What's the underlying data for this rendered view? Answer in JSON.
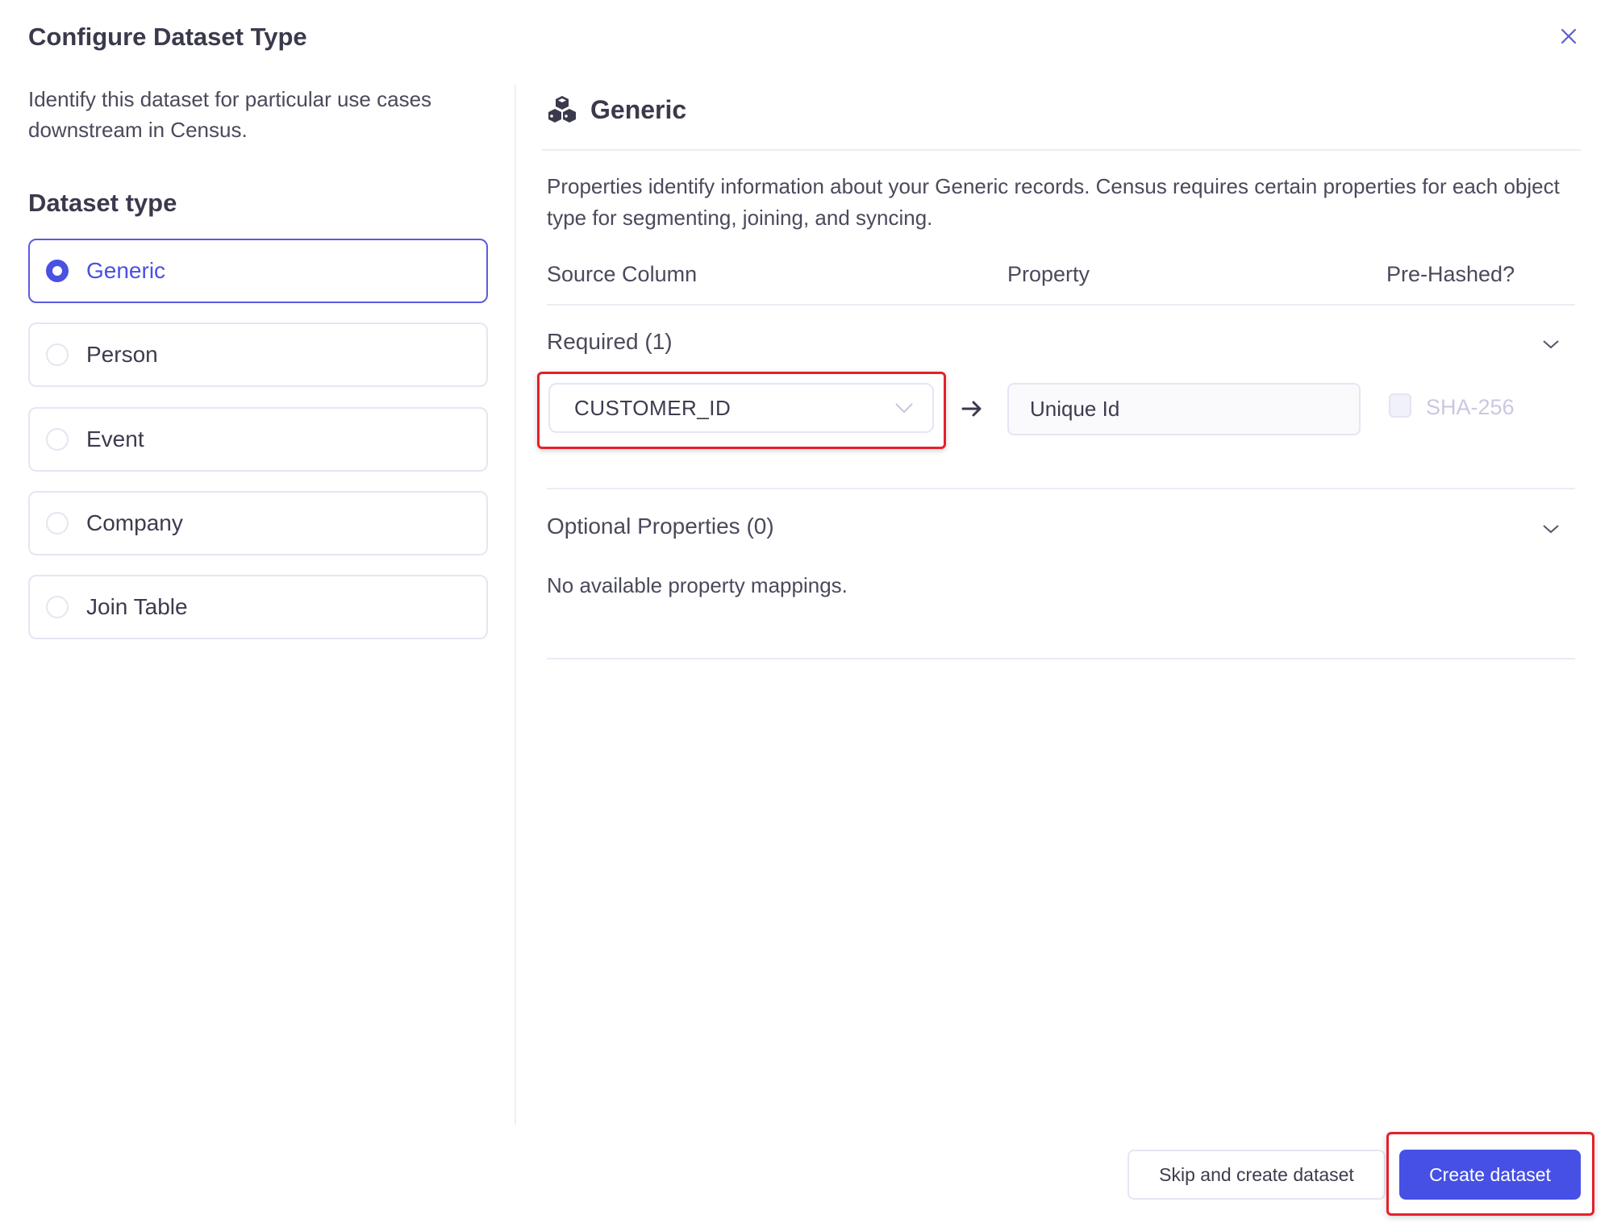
{
  "dialog": {
    "title": "Configure Dataset Type",
    "close_icon": "close-icon"
  },
  "left": {
    "description": "Identify this dataset for particular use cases downstream in Census.",
    "heading": "Dataset type",
    "options": [
      {
        "label": "Generic",
        "selected": true
      },
      {
        "label": "Person",
        "selected": false
      },
      {
        "label": "Event",
        "selected": false
      },
      {
        "label": "Company",
        "selected": false
      },
      {
        "label": "Join Table",
        "selected": false
      }
    ]
  },
  "right": {
    "heading": "Generic",
    "heading_icon": "cubes-icon",
    "description": "Properties identify information about your Generic records. Census requires certain properties for each object type for segmenting, joining, and syncing.",
    "columns": [
      "Source Column",
      "Property",
      "Pre-Hashed?"
    ],
    "required": {
      "title": "Required (1)",
      "rows": [
        {
          "source_column": "CUSTOMER_ID",
          "property": "Unique Id",
          "hash_label": "SHA-256",
          "hashed": false
        }
      ]
    },
    "optional": {
      "title": "Optional Properties (0)",
      "empty_message": "No available property mappings."
    }
  },
  "footer": {
    "skip_label": "Skip and create dataset",
    "create_label": "Create dataset"
  },
  "colors": {
    "accent": "#4650e5",
    "highlight": "#e5202a",
    "text": "#3c3c4f",
    "border": "#e6e5f3"
  }
}
